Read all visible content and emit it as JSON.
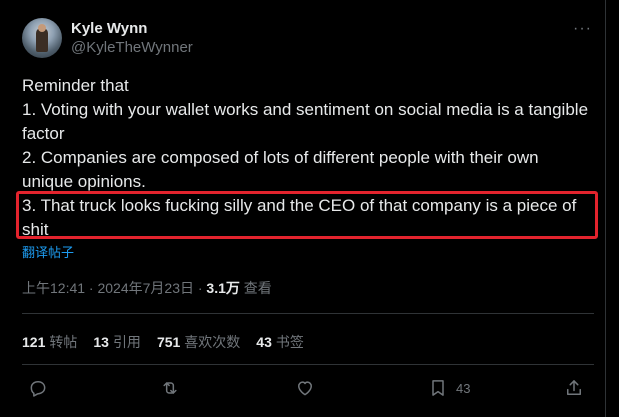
{
  "user": {
    "name": "Kyle Wynn",
    "handle": "@KyleTheWynner",
    "more": "···"
  },
  "tweet": {
    "lines": [
      "Reminder that",
      "1. Voting with your wallet works and sentiment on social media is a tangible factor",
      "2. Companies are composed of lots of different people with their own unique opinions.",
      "3. That truck looks fucking silly and the CEO of that company is a piece of shit"
    ],
    "translate_label": "翻译帖子"
  },
  "meta": {
    "time": "上午12:41 · 2024年7月23日 · ",
    "views_count": "3.1万",
    "views_label": " 查看"
  },
  "stats": {
    "retweets_count": "121",
    "retweets_label": "转帖",
    "quotes_count": "13",
    "quotes_label": "引用",
    "likes_count": "751",
    "likes_label": "喜欢次数",
    "bookmarks_count": "43",
    "bookmarks_label": "书签"
  },
  "actions": {
    "bookmark_count": "43"
  },
  "colors": {
    "background": "#000000",
    "text": "#e7e9ea",
    "muted": "#71767b",
    "link": "#1d9bf0",
    "highlight": "#e3232d",
    "divider": "#2f3336"
  }
}
